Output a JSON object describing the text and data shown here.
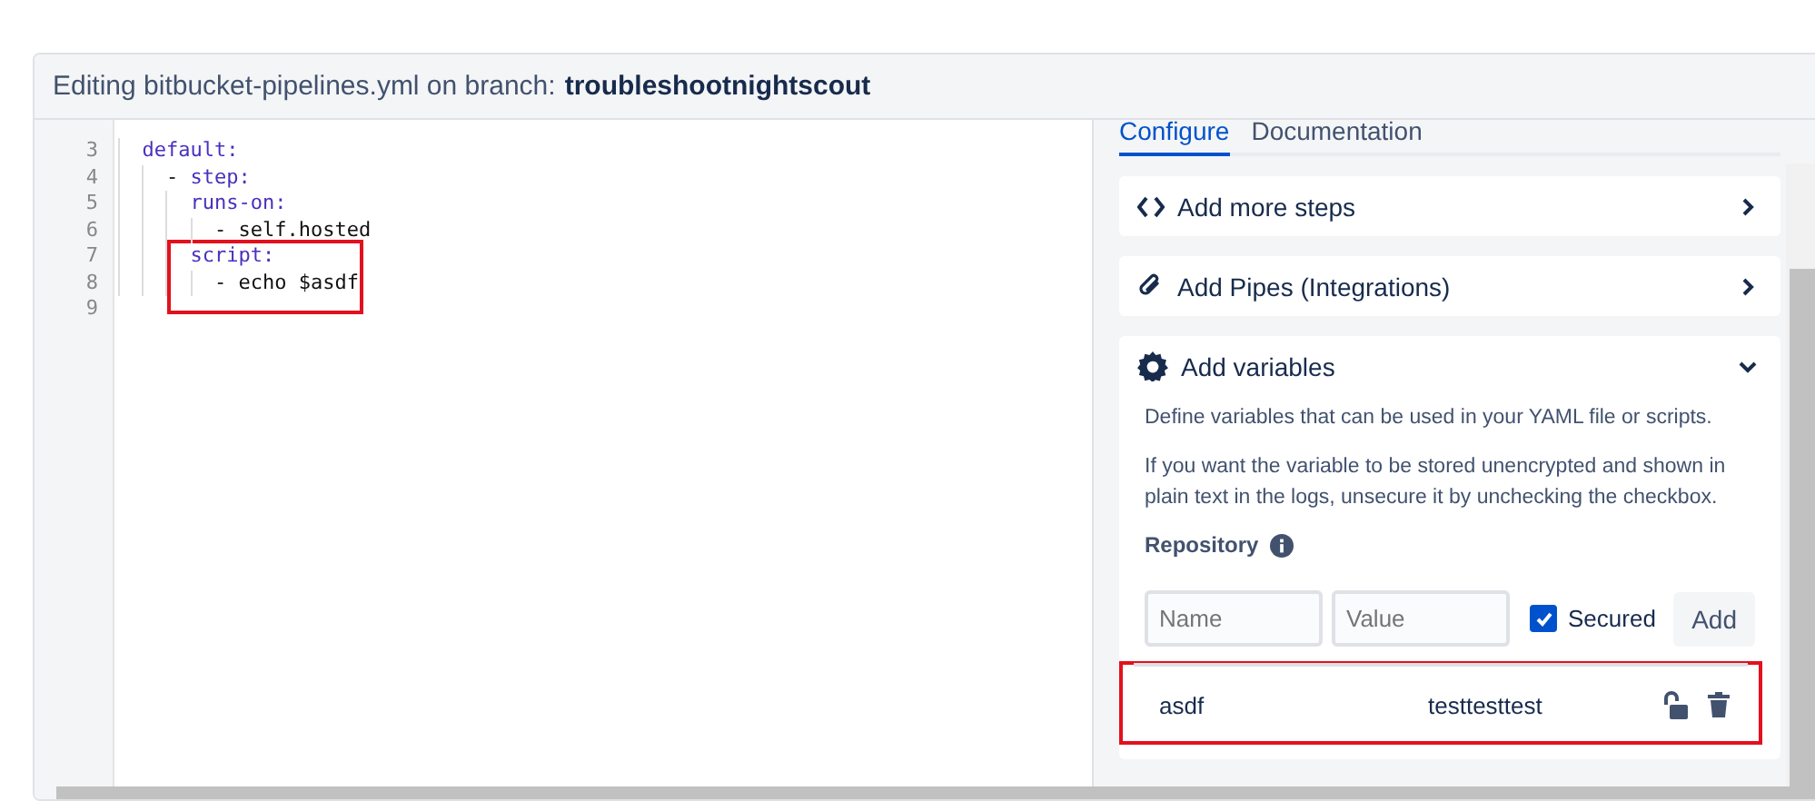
{
  "header": {
    "prefix": "Editing bitbucket-pipelines.yml on branch:",
    "branch": "troubleshootnightscout"
  },
  "editor": {
    "lines": [
      {
        "number": "3",
        "tokens": [
          {
            "text": "  default:",
            "kind": "key"
          }
        ],
        "annotated": false
      },
      {
        "number": "4",
        "tokens": [
          {
            "text": "    - ",
            "kind": "plain"
          },
          {
            "text": "step:",
            "kind": "key"
          }
        ],
        "annotated": false
      },
      {
        "number": "5",
        "tokens": [
          {
            "text": "      runs-on:",
            "kind": "key"
          }
        ],
        "annotated": false
      },
      {
        "number": "6",
        "tokens": [
          {
            "text": "        - self.hosted",
            "kind": "plain"
          }
        ],
        "annotated": false
      },
      {
        "number": "7",
        "tokens": [
          {
            "text": "      script:",
            "kind": "key"
          }
        ],
        "annotated": true
      },
      {
        "number": "8",
        "tokens": [
          {
            "text": "        - echo $asdf",
            "kind": "plain"
          }
        ],
        "annotated": true
      },
      {
        "number": "9",
        "annotated": false
      }
    ]
  },
  "tabs": [
    {
      "label": "Configure",
      "selected": true
    },
    {
      "label": "Documentation",
      "selected": false
    }
  ],
  "sections": [
    {
      "kind": "code",
      "title": "Add more steps",
      "expanded": false
    },
    {
      "kind": "clip",
      "title": "Add Pipes (Integrations)",
      "expanded": false
    },
    {
      "kind": "gear",
      "title": "Add variables",
      "expanded": true,
      "paragraphs": [
        "Define variables that can be used in your YAML file or scripts.",
        "If you want the variable to be stored unencrypted and shown in plain text in the logs, unsecure it by unchecking the checkbox."
      ],
      "subheading": "Repository",
      "form": {
        "name_placeholder": "Name",
        "value_placeholder": "Value",
        "secured_label": "Secured",
        "secured_checked": true,
        "add_label": "Add"
      },
      "variables": [
        {
          "name": "asdf",
          "value": "testtesttest",
          "secured": false,
          "annotated": true
        }
      ]
    }
  ]
}
